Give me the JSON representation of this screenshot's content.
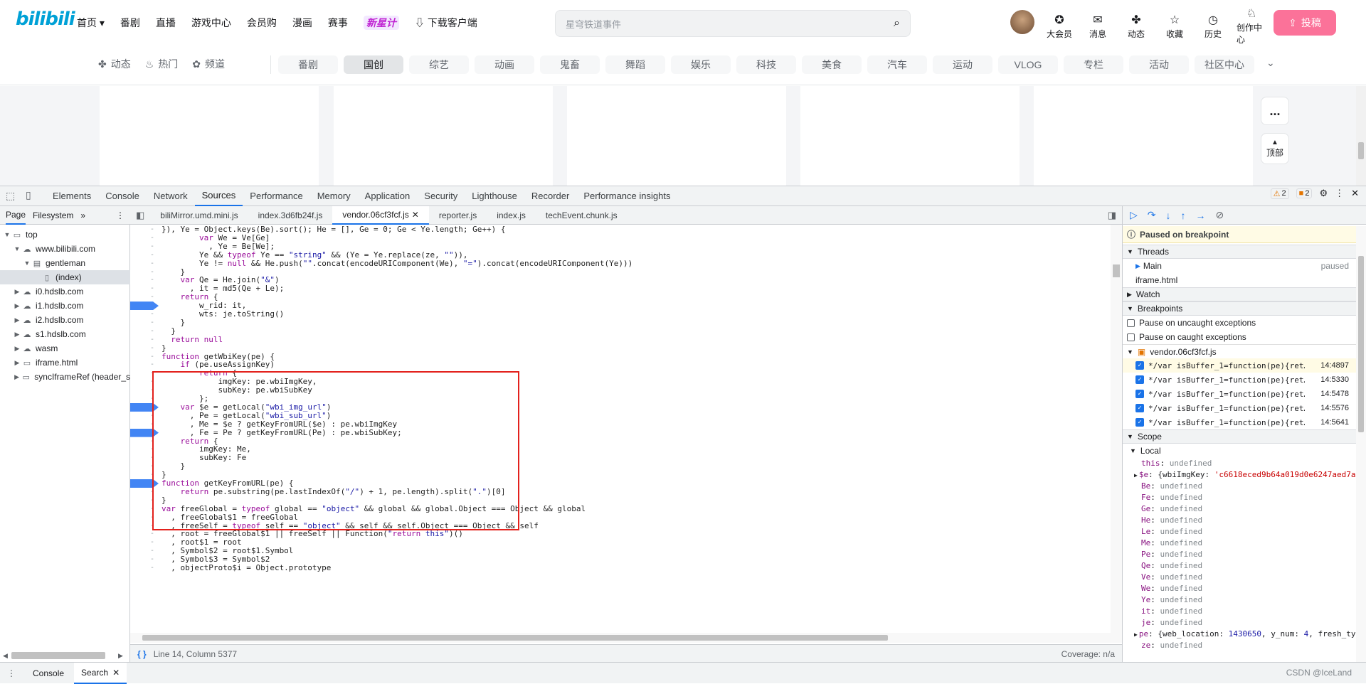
{
  "bili": {
    "logo": "bilibili",
    "nav": [
      "首页",
      "番剧",
      "直播",
      "游戏中心",
      "会员购",
      "漫画",
      "赛事"
    ],
    "nav_special": "新星计",
    "nav_download": "下载客户端",
    "search_placeholder": "星穹铁道事件",
    "header_icons": [
      {
        "label": "大会员",
        "icon": "vip-icon"
      },
      {
        "label": "消息",
        "icon": "message-icon"
      },
      {
        "label": "动态",
        "icon": "dynamic-icon"
      },
      {
        "label": "收藏",
        "icon": "star-icon"
      },
      {
        "label": "历史",
        "icon": "history-icon"
      },
      {
        "label": "创作中心",
        "icon": "creator-icon"
      }
    ],
    "upload_label": "投稿",
    "channel_left": [
      "动态",
      "热门",
      "频道"
    ],
    "channels": [
      "番剧",
      "国创",
      "综艺",
      "动画",
      "鬼畜",
      "舞蹈",
      "娱乐",
      "科技",
      "美食",
      "汽车",
      "运动",
      "VLOG",
      "专栏",
      "活动",
      "社区中心"
    ],
    "active_channel": "国创",
    "side_more": "...",
    "side_top": "顶部"
  },
  "devtools": {
    "tabs": [
      "Elements",
      "Console",
      "Network",
      "Sources",
      "Performance",
      "Memory",
      "Application",
      "Security",
      "Lighthouse",
      "Recorder",
      "Performance insights"
    ],
    "active_tab": "Sources",
    "warn_count": "2",
    "issue_count": "2",
    "nav_tabs": [
      "Page",
      "Filesystem"
    ],
    "tree": [
      {
        "label": "top",
        "depth": 0,
        "icon": "frame"
      },
      {
        "label": "www.bilibili.com",
        "depth": 1,
        "icon": "cloud"
      },
      {
        "label": "gentleman",
        "depth": 2,
        "icon": "folder"
      },
      {
        "label": "(index)",
        "depth": 3,
        "icon": "file",
        "selected": true
      },
      {
        "label": "i0.hdslb.com",
        "depth": 1,
        "icon": "cloud"
      },
      {
        "label": "i1.hdslb.com",
        "depth": 1,
        "icon": "cloud"
      },
      {
        "label": "i2.hdslb.com",
        "depth": 1,
        "icon": "cloud"
      },
      {
        "label": "s1.hdslb.com",
        "depth": 1,
        "icon": "cloud"
      },
      {
        "label": "wasm",
        "depth": 1,
        "icon": "cloud"
      },
      {
        "label": "iframe.html",
        "depth": 1,
        "icon": "frame"
      },
      {
        "label": "syncIframeRef (header_s",
        "depth": 1,
        "icon": "frame"
      }
    ],
    "editor_tabs": [
      "biliMirror.umd.mini.js",
      "index.3d6fb24f.js",
      "vendor.06cf3fcf.js",
      "reporter.js",
      "index.js",
      "techEvent.chunk.js"
    ],
    "active_editor_tab": "vendor.06cf3fcf.js",
    "code_lines": [
      "}), Ye = Object.keys(Be).sort(); He = [], Ge = 0; Ge < Ye.length; Ge++) {",
      "        var We = Ve[Ge]",
      "          , Ye = Be[We];",
      "        Ye && typeof Ye == \"string\" && (Ye = Ye.replace(ze, \"\")),",
      "        Ye != null && He.push(\"\".concat(encodeURIComponent(We), \"=\").concat(encodeURIComponent(Ye)))",
      "    }",
      "    var Qe = He.join(\"&\")",
      "      , it = md5(Qe + Le);",
      "    return {",
      "        w_rid: it,",
      "        wts: je.toString()",
      "    }",
      "  }",
      "  return null",
      "}",
      "function getWbiKey(pe) {",
      "    if (pe.useAssignKey)",
      "        return {",
      "            imgKey: pe.wbiImgKey,",
      "            subKey: pe.wbiSubKey",
      "        };",
      "    var $e = getLocal(\"wbi_img_url\")",
      "      , Pe = getLocal(\"wbi_sub_url\")",
      "      , Me = $e ? getKeyFromURL($e) : pe.wbiImgKey",
      "      , Fe = Pe ? getKeyFromURL(Pe) : pe.wbiSubKey;",
      "    return {",
      "        imgKey: Me,",
      "        subKey: Fe",
      "    }",
      "}",
      "function getKeyFromURL(pe) {",
      "    return pe.substring(pe.lastIndexOf(\"/\") + 1, pe.length).split(\".\")[0]",
      "}",
      "var freeGlobal = typeof global == \"object\" && global && global.Object === Object && global",
      "  , freeGlobal$1 = freeGlobal",
      "  , freeSelf = typeof self == \"object\" && self && self.Object === Object && self",
      "  , root = freeGlobal$1 || freeSelf || Function(\"return this\")()",
      "  , root$1 = root",
      "  , Symbol$2 = root$1.Symbol",
      "  , Symbol$3 = Symbol$2",
      "  , objectProto$i = Object.prototype"
    ],
    "breakpoint_lines": [
      9,
      21,
      24,
      30
    ],
    "status_position": "Line 14, Column 5377",
    "coverage": "Coverage: n/a",
    "paused_text": "Paused on breakpoint",
    "threads_title": "Threads",
    "threads": [
      {
        "name": "Main",
        "state": "paused"
      },
      {
        "name": "iframe.html",
        "state": ""
      }
    ],
    "watch_title": "Watch",
    "breakpoints_title": "Breakpoints",
    "pause_uncaught": "Pause on uncaught exceptions",
    "pause_caught": "Pause on caught exceptions",
    "bp_file": "vendor.06cf3fcf.js",
    "bp_items": [
      {
        "text": "*/var isBuffer_1=function(pe){ret…",
        "loc": "14:4897"
      },
      {
        "text": "*/var isBuffer_1=function(pe){ret…",
        "loc": "14:5330"
      },
      {
        "text": "*/var isBuffer_1=function(pe){ret…",
        "loc": "14:5478"
      },
      {
        "text": "*/var isBuffer_1=function(pe){ret…",
        "loc": "14:5576"
      },
      {
        "text": "*/var isBuffer_1=function(pe){ret…",
        "loc": "14:5641"
      }
    ],
    "scope_title": "Scope",
    "local_title": "Local",
    "scope_vars": [
      {
        "k": "this",
        "v": "undefined",
        "t": "u"
      },
      {
        "k": "$e",
        "v": "{wbiImgKey: 'c6618eced9b64a019d0e6247aed7a",
        "t": "obj"
      },
      {
        "k": "Be",
        "v": "undefined",
        "t": "u"
      },
      {
        "k": "Fe",
        "v": "undefined",
        "t": "u"
      },
      {
        "k": "Ge",
        "v": "undefined",
        "t": "u"
      },
      {
        "k": "He",
        "v": "undefined",
        "t": "u"
      },
      {
        "k": "Le",
        "v": "undefined",
        "t": "u"
      },
      {
        "k": "Me",
        "v": "undefined",
        "t": "u"
      },
      {
        "k": "Pe",
        "v": "undefined",
        "t": "u"
      },
      {
        "k": "Qe",
        "v": "undefined",
        "t": "u"
      },
      {
        "k": "Ve",
        "v": "undefined",
        "t": "u"
      },
      {
        "k": "We",
        "v": "undefined",
        "t": "u"
      },
      {
        "k": "Ye",
        "v": "undefined",
        "t": "u"
      },
      {
        "k": "it",
        "v": "undefined",
        "t": "u"
      },
      {
        "k": "je",
        "v": "undefined",
        "t": "u"
      },
      {
        "k": "pe",
        "v": "{web_location: 1430650, y_num: 4, fresh_ty",
        "t": "obj"
      },
      {
        "k": "ze",
        "v": "undefined",
        "t": "u"
      }
    ],
    "drawer_tabs": [
      "Console",
      "Search"
    ],
    "active_drawer_tab": "Search"
  },
  "watermark": "CSDN @IceLand"
}
